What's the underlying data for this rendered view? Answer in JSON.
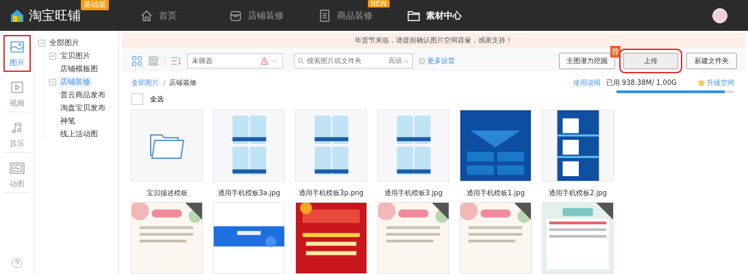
{
  "topbar": {
    "logo": "淘宝旺铺",
    "edition_badge": "基础版",
    "nav": [
      {
        "label": "首页",
        "selected": false
      },
      {
        "label": "店铺装修",
        "selected": false
      },
      {
        "label": "商品装修",
        "selected": false,
        "badge": "NEW"
      },
      {
        "label": "素材中心",
        "selected": true
      }
    ]
  },
  "rail": [
    {
      "label": "图片",
      "selected": true,
      "highlighted": true
    },
    {
      "label": "视频",
      "selected": false,
      "highlighted": false
    },
    {
      "label": "音乐",
      "selected": false,
      "highlighted": false
    },
    {
      "label": "动图",
      "selected": false,
      "highlighted": false
    }
  ],
  "tree": {
    "label": "全部图片",
    "expanded": true,
    "selected": false,
    "children": [
      {
        "label": "宝贝图片",
        "expandable": true,
        "selected": false
      },
      {
        "label": "店铺模板图",
        "expandable": false,
        "selected": false
      },
      {
        "label": "店铺装修",
        "expandable": true,
        "selected": true
      },
      {
        "label": "普云商品发布",
        "expandable": false,
        "selected": false
      },
      {
        "label": "淘盘宝贝发布",
        "expandable": false,
        "selected": false
      },
      {
        "label": "神笔",
        "expandable": false,
        "selected": false
      },
      {
        "label": "线上活动图",
        "expandable": false,
        "selected": false
      }
    ]
  },
  "notice": "年货节来临，请提前确认图片空间容量，感谢支持！",
  "toolbar": {
    "views": [
      {
        "selected": true
      },
      {
        "selected": false
      }
    ],
    "filter": "未筛选",
    "search_placeholder": "搜索图片或文件夹",
    "advanced": "高级",
    "more_settings": "更多设置",
    "buttons": [
      {
        "label": "主图潜力挖掘",
        "badge": "荐",
        "highlighted": false
      },
      {
        "label": "上传",
        "highlighted": true
      },
      {
        "label": "新建文件夹",
        "highlighted": false
      }
    ]
  },
  "breadcrumb": [
    "全部图片",
    "/",
    "店铺装修"
  ],
  "select_all": {
    "label": "全选",
    "checked": false
  },
  "storage": {
    "help": "使用说明",
    "used": "已用 938.38M/ 1.00G",
    "upgrade": "升级空间",
    "level": 0.92
  },
  "items": [
    {
      "kind": "folder",
      "name": "宝贝描述模板"
    },
    {
      "kind": "picture",
      "name": "通用手机模板3a.jpg"
    },
    {
      "kind": "picture",
      "name": "通用手机模板3p.png"
    },
    {
      "kind": "picture",
      "name": "通用手机模板3.jpg"
    },
    {
      "kind": "picture",
      "name": "通用手机模板1.jpg"
    },
    {
      "kind": "picture",
      "name": "通用手机模板2.jpg"
    },
    {
      "kind": "picture"
    },
    {
      "kind": "picture"
    },
    {
      "kind": "picture"
    },
    {
      "kind": "picture"
    },
    {
      "kind": "picture"
    },
    {
      "kind": "picture"
    }
  ]
}
